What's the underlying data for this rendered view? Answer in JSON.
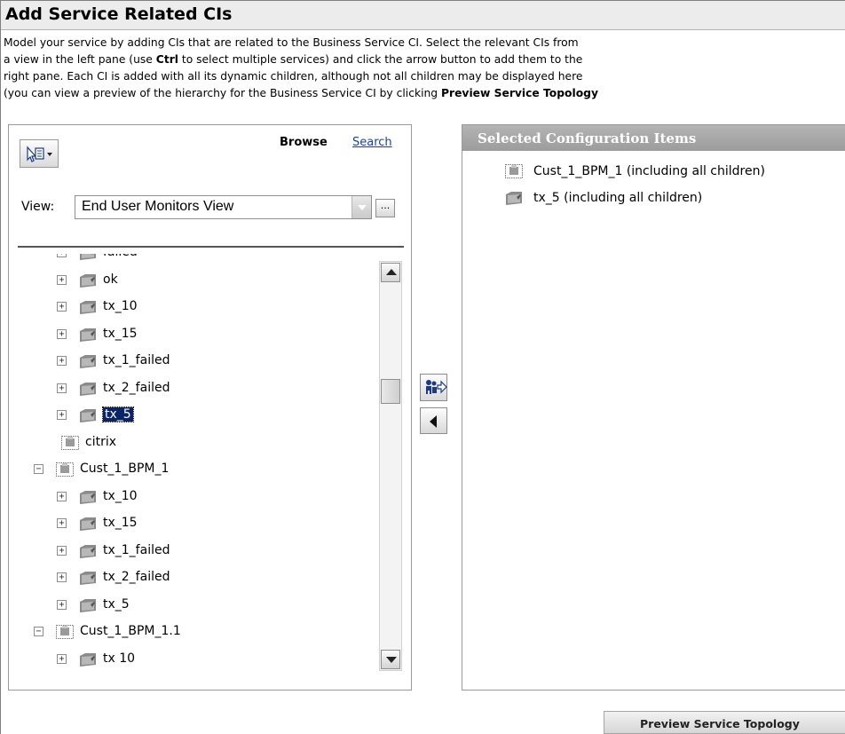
{
  "title": "Add Service Related CIs",
  "description": {
    "line1": "Model your service by adding CIs that are related to the Business Service CI. Select the relevant CIs from",
    "line2_pre": "a view in the left pane (use ",
    "line2_bold": "Ctrl",
    "line2_post": " to select multiple services) and click the arrow button to add them to the",
    "line3": "right pane. Each CI is added with all its dynamic children, although not all children may be displayed here",
    "line4_pre": "(you can view a preview of the hierarchy for the Business Service CI by clicking ",
    "line4_bold": "Preview Service Topology"
  },
  "left": {
    "browse_label": "Browse",
    "search_label": "Search",
    "view_label": "View:",
    "view_value": "End User Monitors View",
    "ellipsis": "...",
    "tree": [
      {
        "label": "failed",
        "type": "folder",
        "expander": "+",
        "level": 1
      },
      {
        "label": "ok",
        "type": "folder",
        "expander": "+",
        "level": 1
      },
      {
        "label": "tx_10",
        "type": "folder",
        "expander": "+",
        "level": 1
      },
      {
        "label": "tx_15",
        "type": "folder",
        "expander": "+",
        "level": 1
      },
      {
        "label": "tx_1_failed",
        "type": "folder",
        "expander": "+",
        "level": 1
      },
      {
        "label": "tx_2_failed",
        "type": "folder",
        "expander": "+",
        "level": 1
      },
      {
        "label": "tx_5",
        "type": "folder",
        "expander": "+",
        "level": 1,
        "selected": true
      },
      {
        "label": "citrix",
        "type": "ci",
        "expander": "",
        "level": 0
      },
      {
        "label": "Cust_1_BPM_1",
        "type": "ci",
        "expander": "−",
        "level": 0
      },
      {
        "label": "tx_10",
        "type": "folder",
        "expander": "+",
        "level": 1
      },
      {
        "label": "tx_15",
        "type": "folder",
        "expander": "+",
        "level": 1
      },
      {
        "label": "tx_1_failed",
        "type": "folder",
        "expander": "+",
        "level": 1
      },
      {
        "label": "tx_2_failed",
        "type": "folder",
        "expander": "+",
        "level": 1
      },
      {
        "label": "tx_5",
        "type": "folder",
        "expander": "+",
        "level": 1
      },
      {
        "label": "Cust_1_BPM_1.1",
        "type": "ci",
        "expander": "−",
        "level": 0
      },
      {
        "label": "tx 10",
        "type": "folder",
        "expander": "+",
        "level": 1
      }
    ]
  },
  "right": {
    "header": "Selected Configuration Items",
    "items": [
      {
        "label": "Cust_1_BPM_1 (including all children)",
        "type": "ci"
      },
      {
        "label": "tx_5 (including all children)",
        "type": "folder"
      }
    ]
  },
  "buttons": {
    "preview": "Preview Service Topology"
  },
  "icons": [
    "toolbar-menu-icon",
    "folder-icon",
    "ci-icon",
    "add-to-selection-icon",
    "remove-arrow-icon"
  ]
}
